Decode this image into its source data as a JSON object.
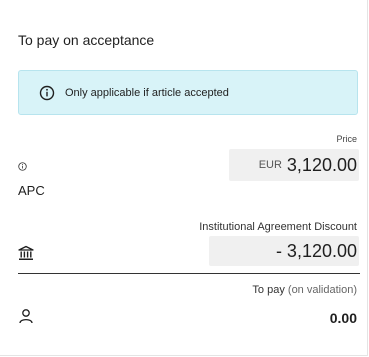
{
  "panel": {
    "title": "To pay on acceptance",
    "info_message": "Only applicable if article accepted",
    "info_icon": "info-circle-icon"
  },
  "price": {
    "label": "Price",
    "currency": "EUR",
    "amount": "3,120.00",
    "item_label": "APC",
    "item_icon": "info-icon"
  },
  "discount": {
    "label": "Institutional Agreement Discount",
    "amount": "- 3,120.00",
    "icon": "institution-bank-icon"
  },
  "to_pay": {
    "label": "To pay",
    "note": "(on validation)",
    "amount": "0.00",
    "icon": "user-icon"
  },
  "colors": {
    "info_bg": "#d8f3f8",
    "info_border": "#b7e4ee",
    "value_bg": "#f0f0f0",
    "text": "#1f1f1f"
  }
}
